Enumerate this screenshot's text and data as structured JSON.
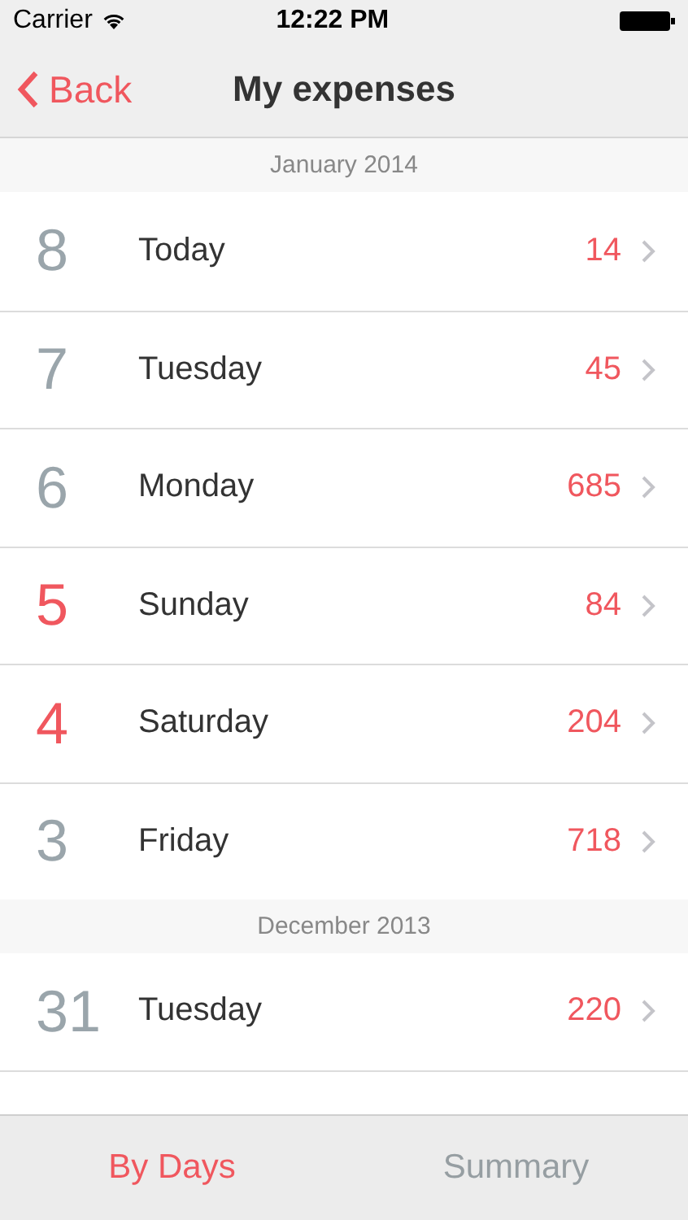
{
  "status_bar": {
    "carrier": "Carrier",
    "time": "12:22 PM"
  },
  "nav": {
    "back": "Back",
    "title": "My expenses"
  },
  "sections": [
    {
      "header": "January 2014",
      "rows": [
        {
          "day": "8",
          "weekday": "Today",
          "amount": "14",
          "weekend": false
        },
        {
          "day": "7",
          "weekday": "Tuesday",
          "amount": "45",
          "weekend": false
        },
        {
          "day": "6",
          "weekday": "Monday",
          "amount": "685",
          "weekend": false
        },
        {
          "day": "5",
          "weekday": "Sunday",
          "amount": "84",
          "weekend": true
        },
        {
          "day": "4",
          "weekday": "Saturday",
          "amount": "204",
          "weekend": true
        },
        {
          "day": "3",
          "weekday": "Friday",
          "amount": "718",
          "weekend": false
        }
      ]
    },
    {
      "header": "December 2013",
      "rows": [
        {
          "day": "31",
          "weekday": "Tuesday",
          "amount": "220",
          "weekend": false
        }
      ]
    }
  ],
  "tabs": [
    {
      "label": "By Days",
      "selected": true
    },
    {
      "label": "Summary",
      "selected": false
    }
  ]
}
